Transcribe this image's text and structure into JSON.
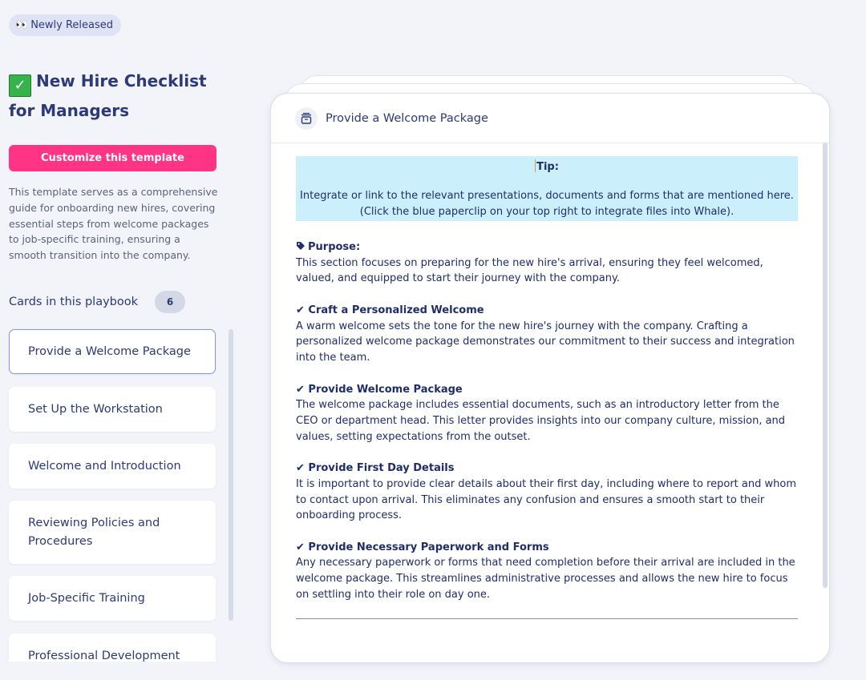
{
  "badge": {
    "icon": "eyes-icon",
    "label": "Newly Released"
  },
  "playbook": {
    "title": "New Hire Checklist for Managers",
    "title_icon": "check-mark-button-icon",
    "cta_label": "Customize this template",
    "description": "This template serves as a comprehensive guide for onboarding new hires, covering essential steps from welcome packages to job-specific training, ensuring a smooth transition into the company.",
    "cards_label": "Cards in this playbook",
    "cards_count": "6",
    "cards": [
      "Provide a Welcome Package",
      "Set Up the Workstation",
      "Welcome and Introduction",
      "Reviewing Policies and Procedures",
      "Job-Specific Training",
      "Professional Development"
    ],
    "active_card": 0
  },
  "panel": {
    "title": "Provide a Welcome Package",
    "title_icon": "package-icon",
    "tip": {
      "label": "Tip:",
      "line1": "Integrate or link to the relevant presentations, documents and forms that are mentioned here.",
      "line2": "(Click the blue paperclip on your top right to integrate files into Whale)."
    },
    "purpose": {
      "heading": "Purpose:",
      "text": "This section focuses on preparing for the new hire's arrival, ensuring they feel welcomed, valued, and equipped to start their journey with the company."
    },
    "sections": [
      {
        "heading": "Craft a Personalized Welcome",
        "text": "A warm welcome sets the tone for the new hire's journey with the company. Crafting a personalized welcome package demonstrates our commitment to their success and integration into the team."
      },
      {
        "heading": "Provide Welcome Package",
        "text": "The welcome package includes essential documents, such as an introductory letter from the CEO or department head. This letter provides insights into our company culture, mission, and values, setting expectations from the outset."
      },
      {
        "heading": "Provide First Day Details",
        "text": "It is important to provide clear details about their first day, including where to report and whom to contact upon arrival. This eliminates any confusion and ensures a smooth start to their onboarding process."
      },
      {
        "heading": "Provide Necessary Paperwork and Forms",
        "text": "Any necessary paperwork or forms that need completion before their arrival are included in the welcome package. This streamlines administrative processes and allows the new hire to focus on settling into their role on day one."
      }
    ]
  },
  "colors": {
    "accent": "#ff3484",
    "text": "#2c3a77",
    "tip_background": "#cbf0fc",
    "page_background": "#f2f4f9"
  }
}
